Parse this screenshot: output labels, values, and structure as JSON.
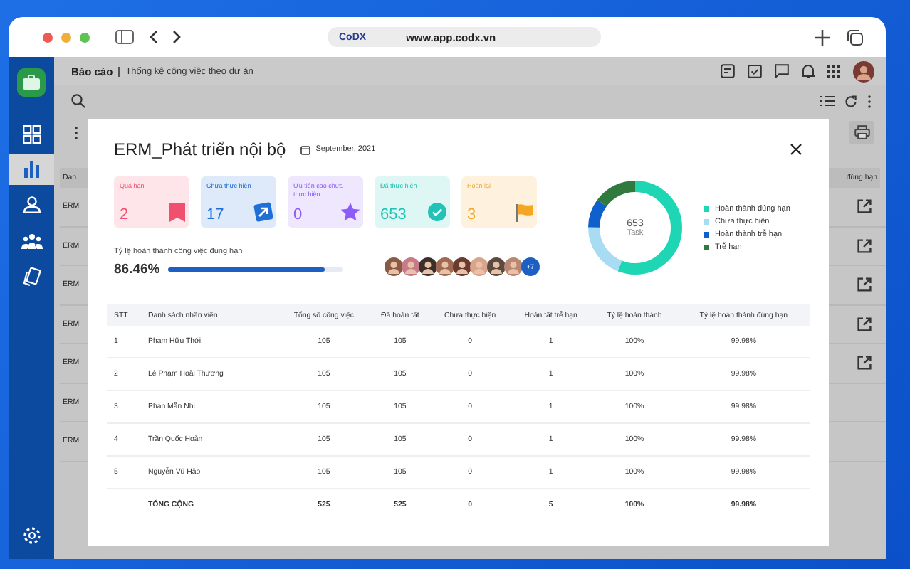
{
  "browser": {
    "logo": "CoDX",
    "url": "www.app.codx.vn"
  },
  "sidebar": {
    "items": [
      {
        "kind": "grid",
        "selected": false
      },
      {
        "kind": "chart",
        "selected": true
      },
      {
        "kind": "person",
        "selected": false
      },
      {
        "kind": "team",
        "selected": false
      },
      {
        "kind": "cards",
        "selected": false
      }
    ]
  },
  "header": {
    "section": "Báo cáo",
    "page": "Thống kê công việc theo dự án"
  },
  "background_table": {
    "column_1": "Dan",
    "column_2": "đúng hạn",
    "rows": [
      {
        "label": "ERM",
        "edit": true
      },
      {
        "label": "ERM",
        "edit": true
      },
      {
        "label": "ERM",
        "edit": true
      },
      {
        "label": "ERM",
        "edit": true
      },
      {
        "label": "ERM",
        "edit": true
      },
      {
        "label": "ERM",
        "edit": false
      },
      {
        "label": "ERM",
        "edit": false
      }
    ]
  },
  "modal": {
    "title": "ERM_Phát triển nội bộ",
    "date": "September, 2021",
    "cards": [
      {
        "kind": "overdue",
        "label": "Quá hạn",
        "value": "2",
        "color": "#f0506e"
      },
      {
        "kind": "todo",
        "label": "Chưa thực hiện",
        "value": "17",
        "color": "#1f6fd6"
      },
      {
        "kind": "priority",
        "label": "Ưu tiên cao chưa thực hiện",
        "value": "0",
        "color": "#8b5cf6"
      },
      {
        "kind": "done",
        "label": "Đã thực hiện",
        "value": "653",
        "color": "#22c3b6"
      },
      {
        "kind": "postponed",
        "label": "Hoãn lại",
        "value": "3",
        "color": "#f5a623"
      }
    ],
    "progress": {
      "label": "Tỷ lệ hoàn thành công việc đúng hạn",
      "reading": "86.46%",
      "level": 0.89
    },
    "team": {
      "more": "+7"
    },
    "donut": {
      "total": "653",
      "unit": "Task",
      "legend": [
        {
          "label": "Hoàn thành đúng hạn",
          "color": "#1fd6b4"
        },
        {
          "label": "Chưa thực hiện",
          "color": "#a8dcf2"
        },
        {
          "label": "Hoàn thành trễ hạn",
          "color": "#0f5fcc"
        },
        {
          "label": "Trễ hạn",
          "color": "#2f7a3c"
        }
      ]
    },
    "table": {
      "columns": [
        "STT",
        "Danh sách nhân viên",
        "Tổng số công việc",
        "Đã hoàn tất",
        "Chưa thực hiện",
        "Hoàn tất trễ hạn",
        "Tỷ lệ hoàn thành",
        "Tỷ lệ hoàn thành đúng hạn"
      ],
      "rows": [
        {
          "kind": "row",
          "cells": [
            "1",
            "Phạm Hữu Thới",
            "105",
            "105",
            "0",
            "1",
            "100%",
            "99.98%"
          ]
        },
        {
          "kind": "row",
          "cells": [
            "2",
            "Lê Phạm Hoài Thương",
            "105",
            "105",
            "0",
            "1",
            "100%",
            "99.98%"
          ]
        },
        {
          "kind": "row",
          "cells": [
            "3",
            "Phan Mẫn Nhi",
            "105",
            "105",
            "0",
            "1",
            "100%",
            "99.98%"
          ]
        },
        {
          "kind": "row",
          "cells": [
            "4",
            "Trần Quốc Hoàn",
            "105",
            "105",
            "0",
            "1",
            "100%",
            "99.98%"
          ]
        },
        {
          "kind": "row",
          "cells": [
            "5",
            "Nguyễn Vũ Hảo",
            "105",
            "105",
            "0",
            "1",
            "100%",
            "99.98%"
          ]
        },
        {
          "kind": "total",
          "cells": [
            "",
            "TỔNG CỘNG",
            "525",
            "525",
            "0",
            "5",
            "100%",
            "99.98%"
          ]
        }
      ]
    }
  }
}
